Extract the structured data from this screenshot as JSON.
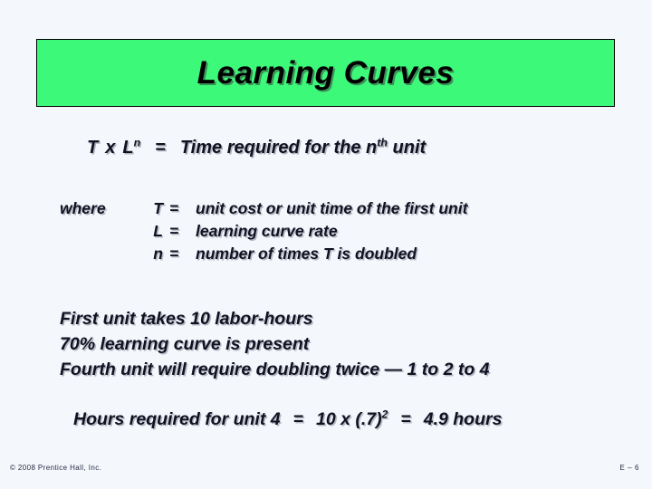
{
  "slide": {
    "title": "Learning Curves",
    "banner_color": "#3df97a",
    "background_color": "#f4f8fd",
    "text_color": "#111122"
  },
  "formula": {
    "term_t": "T",
    "times": "x",
    "term_l": "L",
    "exponent_n": "n",
    "equals": "=",
    "description_prefix": "Time required for the n",
    "description_sup": "th",
    "description_suffix": " unit"
  },
  "where_block": {
    "label": "where",
    "rows": [
      {
        "symbol": "T",
        "equals": "=",
        "definition": "unit cost or unit time of the first unit"
      },
      {
        "symbol": "L",
        "equals": "=",
        "definition": "learning curve rate"
      },
      {
        "symbol": "n",
        "equals": "=",
        "definition": "number of times T is doubled"
      }
    ]
  },
  "body": {
    "lines": [
      "First unit takes 10 labor-hours",
      "70% learning curve is present",
      "Fourth unit will require doubling twice — 1 to 2 to 4"
    ]
  },
  "result": {
    "prefix": "Hours required for unit 4",
    "equals_1": "=",
    "expression_base": "10 x (.7)",
    "expression_sup": "2",
    "equals_2": "=",
    "value": "4.9 hours"
  },
  "footer": {
    "copyright": "© 2008 Prentice Hall, Inc.",
    "page_label": "E – 6"
  }
}
